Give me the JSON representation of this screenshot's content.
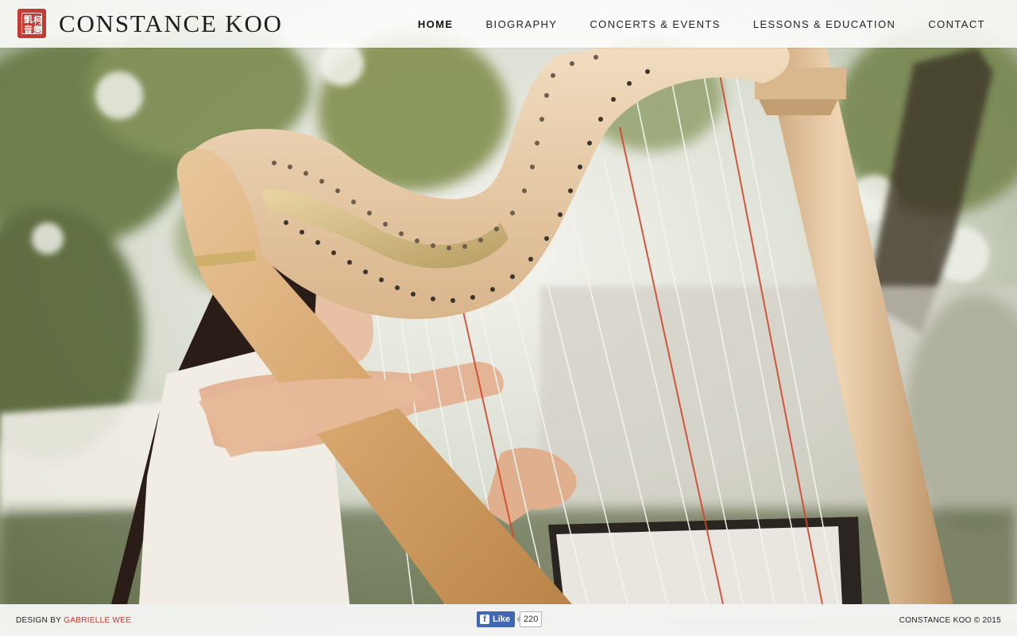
{
  "header": {
    "title": "CONSTANCE KOO",
    "logo": {
      "icon": "red-seal-logo-icon",
      "color": "#c33b32"
    },
    "nav": [
      {
        "label": "HOME",
        "active": true
      },
      {
        "label": "BIOGRAPHY",
        "active": false
      },
      {
        "label": "CONCERTS & EVENTS",
        "active": false
      },
      {
        "label": "LESSONS & EDUCATION",
        "active": false
      },
      {
        "label": "CONTACT",
        "active": false
      }
    ]
  },
  "hero": {
    "image": "harp-player-hero-photo"
  },
  "footer": {
    "design_prefix": "DESIGN BY",
    "designer_link": "GABRIELLE WEE",
    "facebook": {
      "like_label": "Like",
      "count": "220",
      "icon": "facebook-f-icon"
    },
    "copyright": "CONSTANCE KOO © 2015"
  },
  "colors": {
    "accent": "#c33b32",
    "facebook_blue": "#4267b2"
  }
}
